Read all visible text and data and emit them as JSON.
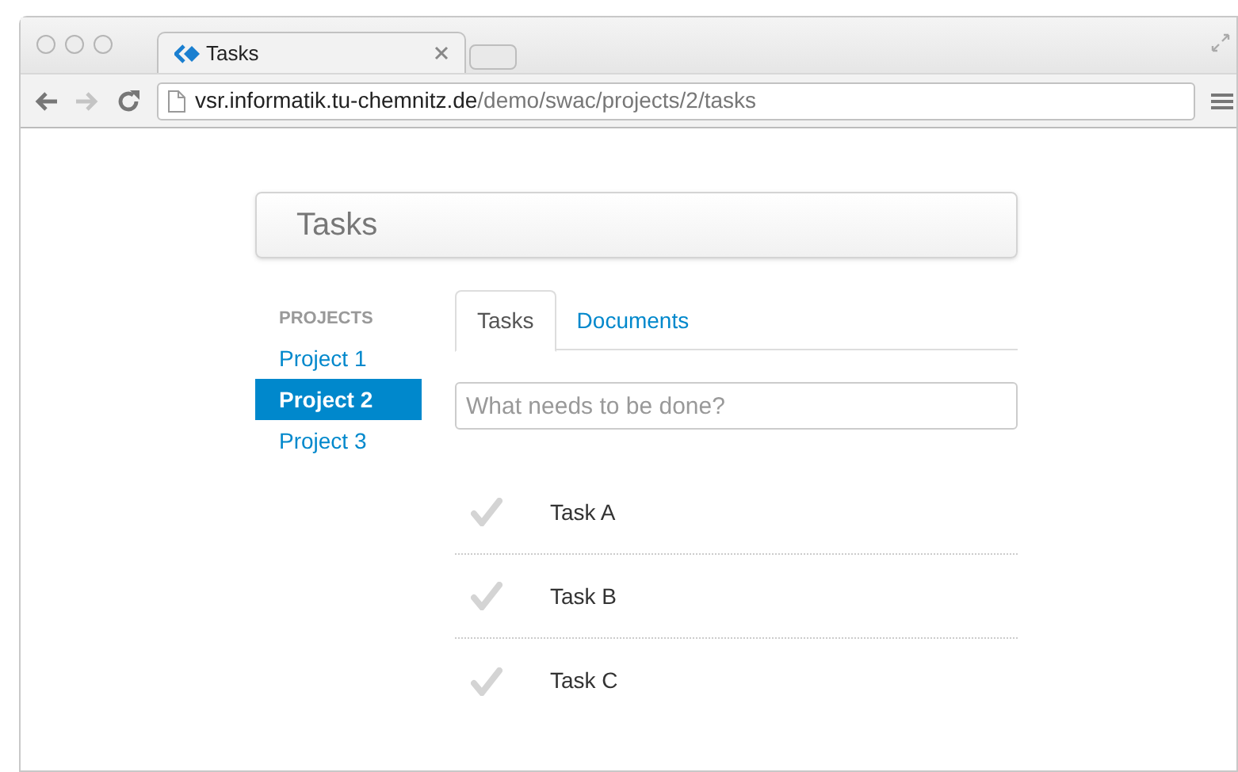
{
  "browser": {
    "tabs": [
      {
        "title": "Tasks",
        "selected": true
      }
    ],
    "address": {
      "host": "vsr.informatik.tu-chemnitz.de",
      "path": "/demo/swac/projects/2/tasks"
    }
  },
  "page": {
    "header": "Tasks",
    "sidebar": {
      "heading": "PROJECTS",
      "items": [
        {
          "label": "Project 1",
          "selected": false
        },
        {
          "label": "Project 2",
          "selected": true
        },
        {
          "label": "Project 3",
          "selected": false
        }
      ]
    },
    "tabs": [
      {
        "label": "Tasks",
        "selected": true
      },
      {
        "label": "Documents",
        "selected": false
      }
    ],
    "new_task": {
      "placeholder": "What needs to be done?"
    },
    "tasks": [
      {
        "title": "Task A",
        "done": false
      },
      {
        "title": "Task B",
        "done": false
      },
      {
        "title": "Task C",
        "done": false
      }
    ]
  }
}
